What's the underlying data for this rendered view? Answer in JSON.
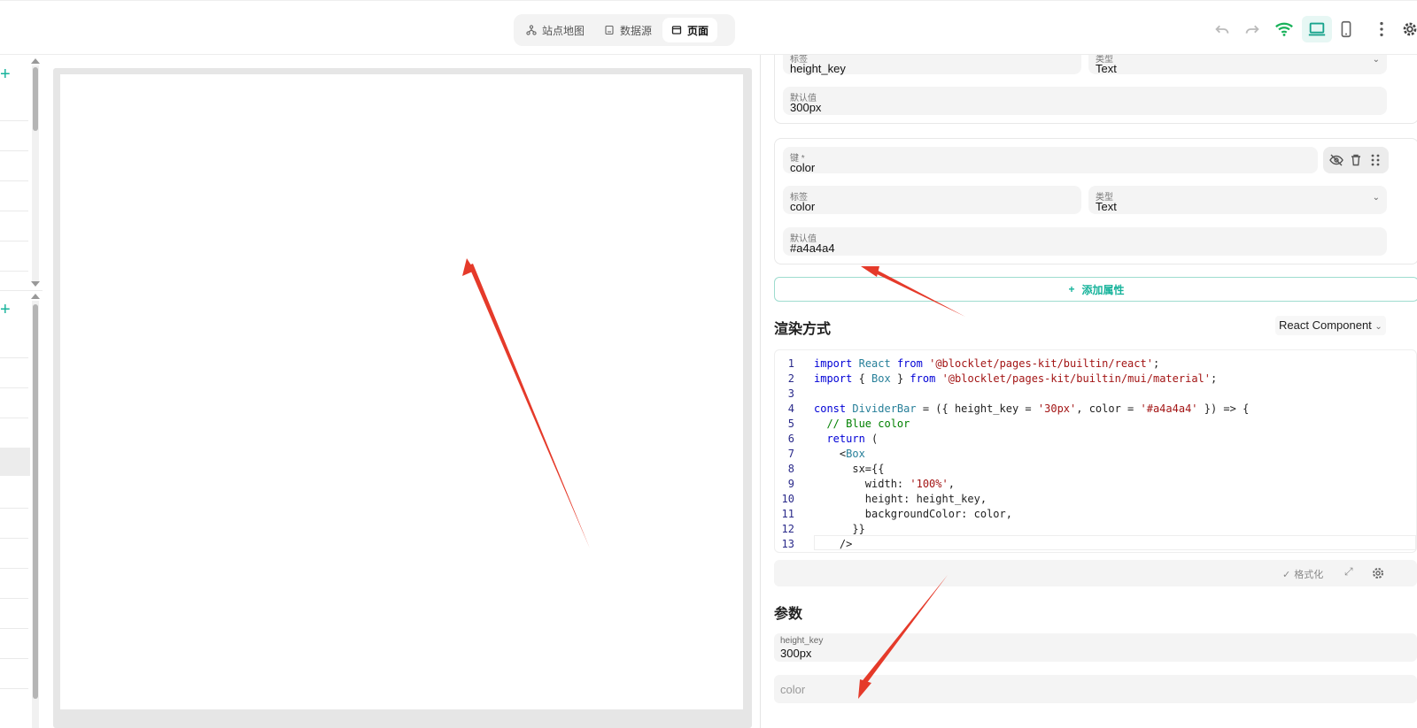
{
  "toolbar": {
    "tabs": [
      {
        "label": "站点地图",
        "icon": "sitemap-icon",
        "active": false
      },
      {
        "label": "数据源",
        "icon": "datasource-icon",
        "active": false
      },
      {
        "label": "页面",
        "icon": "page-icon",
        "active": true
      }
    ],
    "icons": [
      "undo-icon",
      "redo-icon",
      "wifi-icon",
      "laptop-icon",
      "phone-icon",
      "more-icon",
      "settings-icon"
    ],
    "accent": "#17b39b"
  },
  "properties": {
    "prop1": {
      "label_caption": "标签",
      "label_value": "height_key",
      "type_caption": "类型",
      "type_value": "Text",
      "default_caption": "默认值",
      "default_value": "300px"
    },
    "prop2": {
      "key_caption": "键 *",
      "key_value": "color",
      "label_caption": "标签",
      "label_value": "color",
      "type_caption": "类型",
      "type_value": "Text",
      "default_caption": "默认值",
      "default_value": "#a4a4a4"
    },
    "add_button": "添加属性"
  },
  "render": {
    "title": "渲染方式",
    "mode": "React Component",
    "code_lines": [
      {
        "n": "1",
        "text": "import React from '@blocklet/pages-kit/builtin/react';"
      },
      {
        "n": "2",
        "text": "import { Box } from '@blocklet/pages-kit/builtin/mui/material';"
      },
      {
        "n": "3",
        "text": ""
      },
      {
        "n": "4",
        "text": "const DividerBar = ({ height_key = '30px', color = '#a4a4a4' }) => {"
      },
      {
        "n": "5",
        "text": "  // Blue color"
      },
      {
        "n": "6",
        "text": "  return ("
      },
      {
        "n": "7",
        "text": "    <Box"
      },
      {
        "n": "8",
        "text": "      sx={{"
      },
      {
        "n": "9",
        "text": "        width: '100%',"
      },
      {
        "n": "10",
        "text": "        height: height_key,"
      },
      {
        "n": "11",
        "text": "        backgroundColor: color,"
      },
      {
        "n": "12",
        "text": "      }}"
      },
      {
        "n": "13",
        "text": "    />"
      }
    ],
    "format_label": "格式化"
  },
  "params": {
    "title": "参数",
    "height_caption": "height_key",
    "height_value": "300px",
    "color_placeholder": "color"
  }
}
